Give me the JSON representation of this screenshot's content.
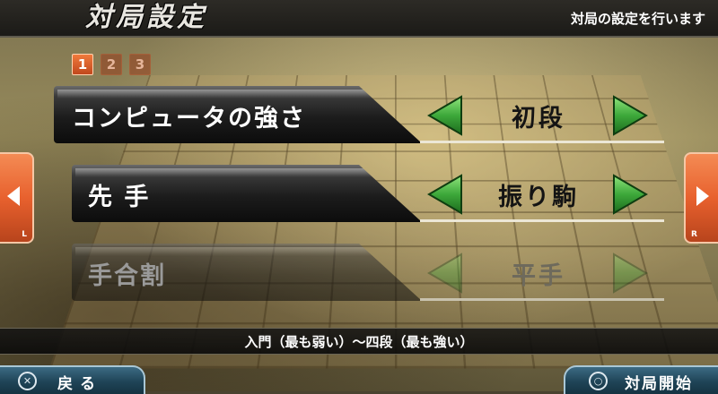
{
  "header": {
    "title": "対局設定",
    "description": "対局の設定を行います"
  },
  "pages": [
    "1",
    "2",
    "3"
  ],
  "active_page": "1",
  "options": [
    {
      "label": "コンピュータの強さ",
      "value": "初段",
      "enabled": true
    },
    {
      "label": "先 手",
      "value": "振り駒",
      "enabled": true
    },
    {
      "label": "手合割",
      "value": "平手",
      "enabled": false
    }
  ],
  "side_tabs": {
    "left_key": "L",
    "right_key": "R"
  },
  "hint": "入門（最も弱い）〜四段（最も強い）",
  "buttons": {
    "back": {
      "glyph": "✕",
      "label": "戻る"
    },
    "start": {
      "glyph": "○",
      "label": "対局開始"
    }
  },
  "colors": {
    "accent": "#e8612e",
    "arrow_green": "#3da83a",
    "button_blue": "#1f4457"
  }
}
